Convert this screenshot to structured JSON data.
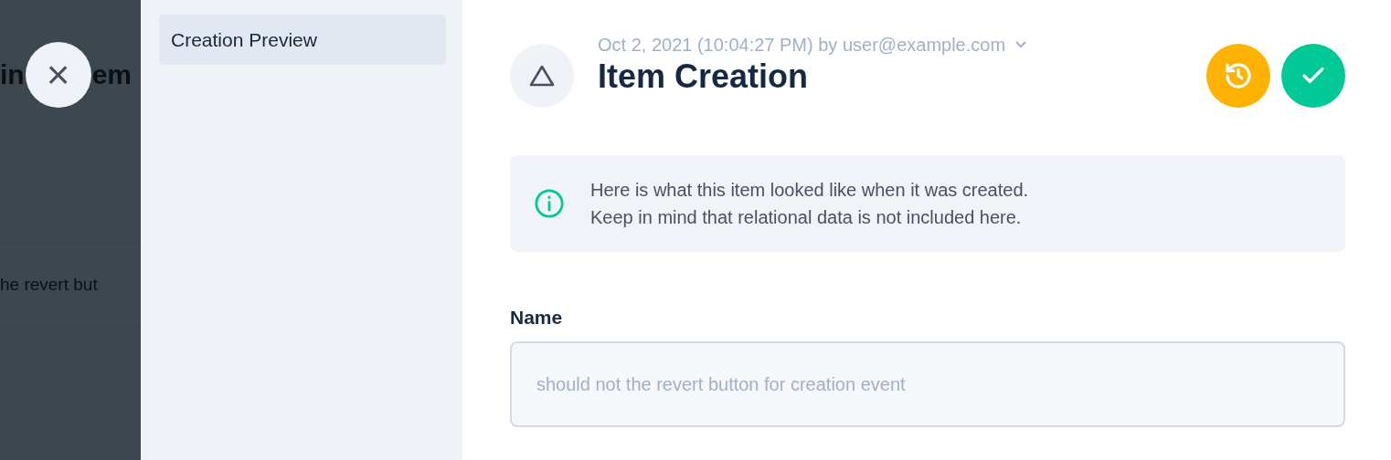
{
  "background_page": {
    "title_fragments": [
      "in",
      "em"
    ],
    "row_text": "he revert but"
  },
  "close_button": {
    "label": "×"
  },
  "sidebar": {
    "items": [
      {
        "label": "Creation Preview",
        "selected": true
      }
    ]
  },
  "header": {
    "meta": "Oct 2, 2021 (10:04:27 PM) by user@example.com",
    "title": "Item Creation"
  },
  "actions": [
    {
      "kind": "revert",
      "color": "#ffb300"
    },
    {
      "kind": "confirm",
      "color": "#00c897"
    }
  ],
  "notice": {
    "lines": [
      "Here is what this item looked like when it was created.",
      "Keep in mind that relational data is not included here."
    ]
  },
  "fields": [
    {
      "label": "Name",
      "value": "should not the revert button for creation event",
      "disabled": true
    }
  ]
}
